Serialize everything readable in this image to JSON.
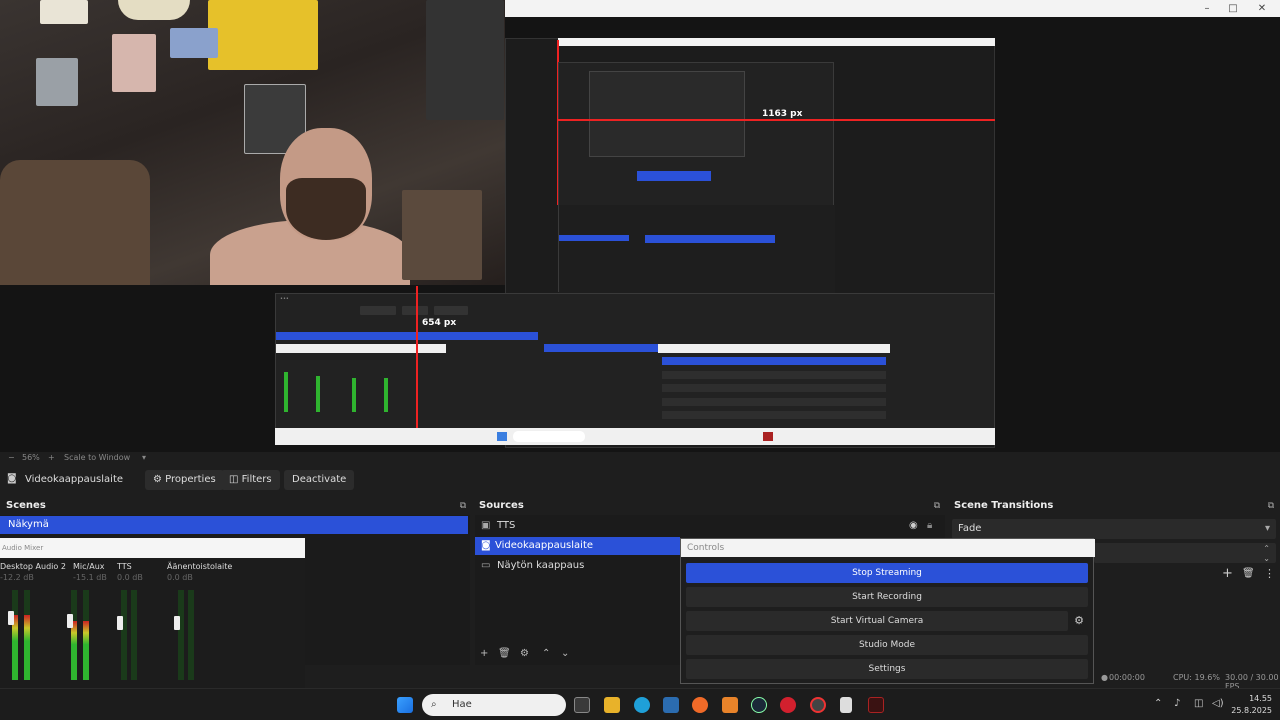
{
  "preview": {
    "inner_label_1163": "1163 px",
    "inner_label_654": "654 px",
    "zoom_percent": "56%",
    "zoom_mode": "Scale to Window"
  },
  "toolbar": {
    "source_name": "Videokaappauslaite",
    "properties_label": "Properties",
    "filters_label": "Filters",
    "deactivate_label": "Deactivate"
  },
  "scenes": {
    "title": "Scenes",
    "items": [
      "Näkymä"
    ]
  },
  "sources": {
    "title": "Sources",
    "items": [
      "TTS",
      "Videokaappauslaite",
      "Näytön kaappaus"
    ]
  },
  "transitions": {
    "title": "Scene Transitions",
    "selected": "Fade"
  },
  "mixer": {
    "title": "Audio Mixer",
    "channels": [
      {
        "name": "Desktop Audio 2",
        "db": "-12.2 dB",
        "level": 0.72
      },
      {
        "name": "Mic/Aux",
        "db": "-15.1 dB",
        "level": 0.65
      },
      {
        "name": "TTS",
        "db": "0.0 dB",
        "level": 0.0
      },
      {
        "name": "Äänentoistolaite",
        "db": "0.0 dB",
        "level": 0.0
      }
    ]
  },
  "controls": {
    "title": "Controls",
    "stop_streaming": "Stop Streaming",
    "start_recording": "Start Recording",
    "start_virtual_camera": "Start Virtual Camera",
    "studio_mode": "Studio Mode",
    "settings": "Settings"
  },
  "status": {
    "time": "00:00:00",
    "cpu": "CPU: 19.6%",
    "fps": "30.00 / 30.00 FPS"
  },
  "taskbar": {
    "search_placeholder": "Hae",
    "clock_time": "14.55",
    "clock_date": "25.8.2025"
  },
  "colors": {
    "accent": "#2b51d8",
    "panel_bg": "#1e1e1e"
  }
}
